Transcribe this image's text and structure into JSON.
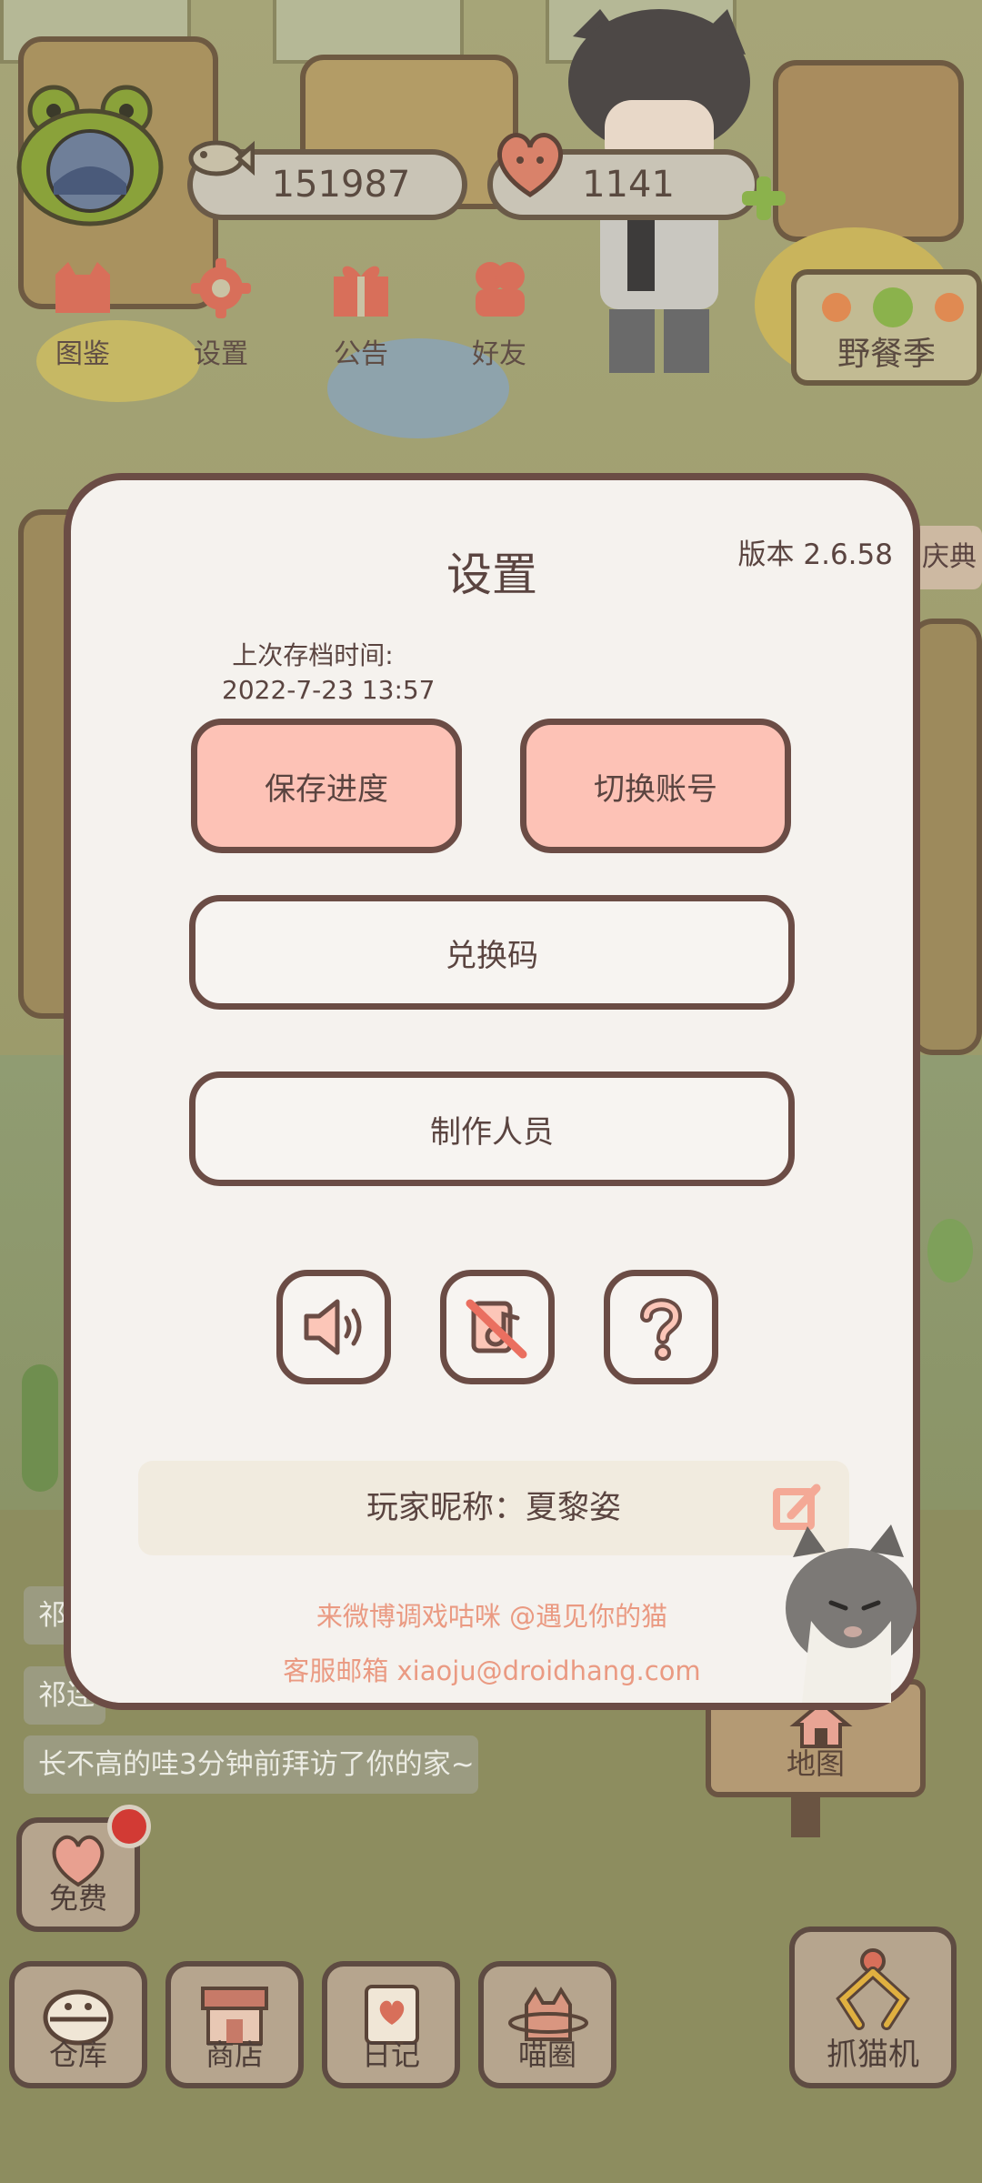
{
  "currency": {
    "fish": "151987",
    "hearts": "1141"
  },
  "top_menu": [
    {
      "label": "图鉴"
    },
    {
      "label": "设置"
    },
    {
      "label": "公告"
    },
    {
      "label": "好友"
    }
  ],
  "event_sign": {
    "label": "野餐季"
  },
  "side_tag": {
    "label": "庆典"
  },
  "dialog": {
    "title": "设置",
    "version": "版本 2.6.58",
    "last_save_label": "上次存档时间:",
    "last_save_time": "2022-7-23 13:57",
    "save_button": "保存进度",
    "switch_account_button": "切换账号",
    "redeem_button": "兑换码",
    "credits_button": "制作人员",
    "sound_icon": "speaker-icon",
    "music_icon": "music-off-icon",
    "help_icon": "question-icon",
    "nickname_label": "玩家昵称：",
    "nickname_value": "夏黎姿",
    "weibo_line": "来微博调戏咕咪 @遇见你的猫",
    "email_line": "客服邮箱 xiaoju@droidhang.com"
  },
  "feed": {
    "line1": "祁",
    "line2": "祁连",
    "line3": "长不高的哇3分钟前拜访了你的家~"
  },
  "map_button": {
    "label": "地图"
  },
  "free_button": {
    "label": "免费"
  },
  "bottom_nav": [
    {
      "label": "仓库"
    },
    {
      "label": "商店"
    },
    {
      "label": "日记"
    },
    {
      "label": "喵圈"
    }
  ],
  "claw_machine": {
    "label": "抓猫机"
  },
  "colors": {
    "dialog_bg": "#f5f2ee",
    "border": "#6b4c45",
    "pink_button": "#fdc2b6",
    "promo_text": "#ea9a82"
  }
}
